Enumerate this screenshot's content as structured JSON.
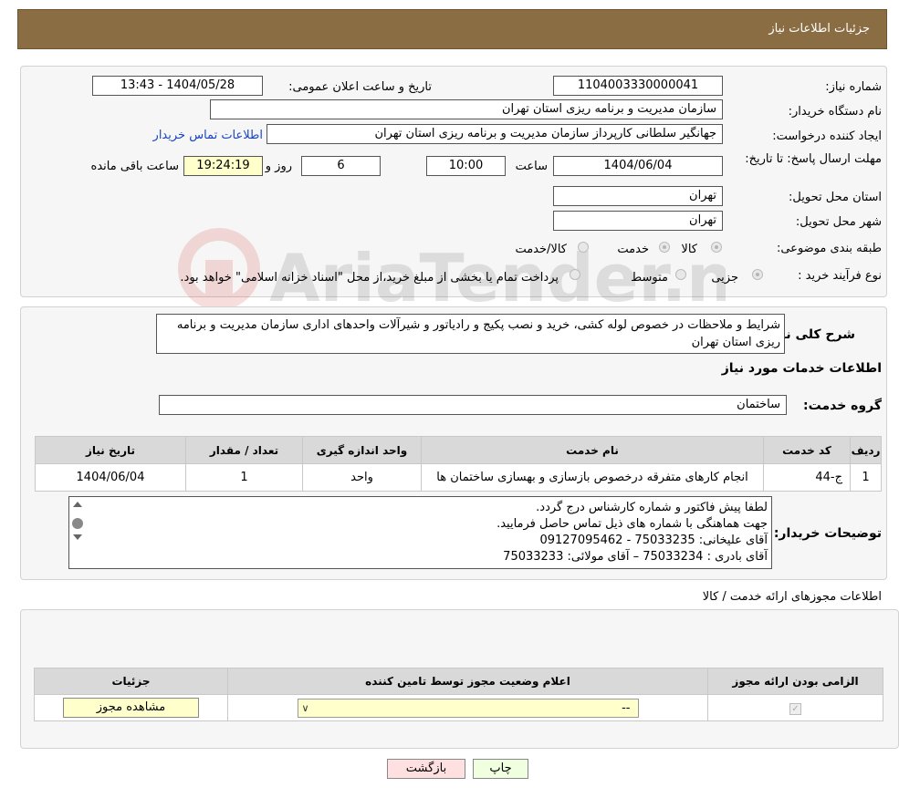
{
  "header": {
    "title": "جزئیات اطلاعات نیاز"
  },
  "watermark": {
    "text": "AriaTender.neT"
  },
  "info": {
    "need_number_label": "شماره نیاز:",
    "need_number": "1104003330000041",
    "announce_label": "تاریخ و ساعت اعلان عمومی:",
    "announce_value": "1404/05/28 - 13:43",
    "buyer_org_label": "نام دستگاه خریدار:",
    "buyer_org": "سازمان مدیریت و برنامه ریزی استان تهران",
    "creator_label": "ایجاد کننده درخواست:",
    "creator": "جهانگیر سلطانی کارپرداز سازمان مدیریت و برنامه ریزی استان تهران",
    "contact_link": "اطلاعات تماس خریدار",
    "deadline_label": "مهلت ارسال پاسخ: تا تاریخ:",
    "deadline_date": "1404/06/04",
    "time_label": "ساعت",
    "deadline_time": "10:00",
    "days_value": "6",
    "days_label": "روز و",
    "remaining_time": "19:24:19",
    "remaining_label": "ساعت باقی مانده",
    "province_label": "استان محل تحویل:",
    "province": "تهران",
    "city_label": "شهر محل تحویل:",
    "city": "تهران",
    "category_label": "طبقه بندی موضوعی:",
    "category_options": [
      "کالا",
      "خدمت",
      "کالا/خدمت"
    ],
    "process_label": "نوع فرآیند خرید :",
    "process_options": [
      "جزیی",
      "متوسط"
    ],
    "process_note": "پرداخت تمام یا بخشی از مبلغ خرید،از محل \"اسناد خزانه اسلامی\" خواهد بود."
  },
  "summary": {
    "label": "شرح کلی نیاز:",
    "text": "شرایط و ملاحظات در خصوص لوله کشی، خرید و نصب پکیج و رادیاتور و شیرآلات واحدهای اداری سازمان مدیریت و برنامه ریزی استان تهران"
  },
  "services": {
    "title": "اطلاعات خدمات مورد نیاز",
    "group_label": "گروه خدمت:",
    "group_value": "ساختمان",
    "columns": [
      "ردیف",
      "کد خدمت",
      "نام خدمت",
      "واحد اندازه گیری",
      "تعداد / مقدار",
      "تاریخ نیاز"
    ],
    "rows": [
      [
        "1",
        "ج-44",
        "انجام کارهای متفرقه درخصوص بازسازی و بهسازی ساختمان ها",
        "واحد",
        "1",
        "1404/06/04"
      ]
    ]
  },
  "buyer_notes": {
    "label": "توضیحات خریدار:",
    "lines": [
      "لطفا پیش فاکتور و شماره کارشناس درج گردد.",
      "جهت هماهنگی با شماره های ذیل تماس حاصل فرمایید.",
      "آقای علیخانی: 75033235 - 09127095462",
      "آقای بادری : 75033234 – آقای مولائی: 75033233"
    ]
  },
  "permits": {
    "title": "اطلاعات مجوزهای ارائه خدمت / کالا",
    "columns": [
      "الزامی بودن ارائه مجوز",
      "اعلام وضعیت مجوز توسط تامین کننده",
      "جزئیات"
    ],
    "select_value": "--",
    "view_button": "مشاهده مجوز"
  },
  "buttons": {
    "print": "چاپ",
    "back": "بازگشت"
  },
  "colors": {
    "header_bg": "#8b6d43",
    "yellow_field": "#ffffcc",
    "link": "#1a44c4"
  }
}
